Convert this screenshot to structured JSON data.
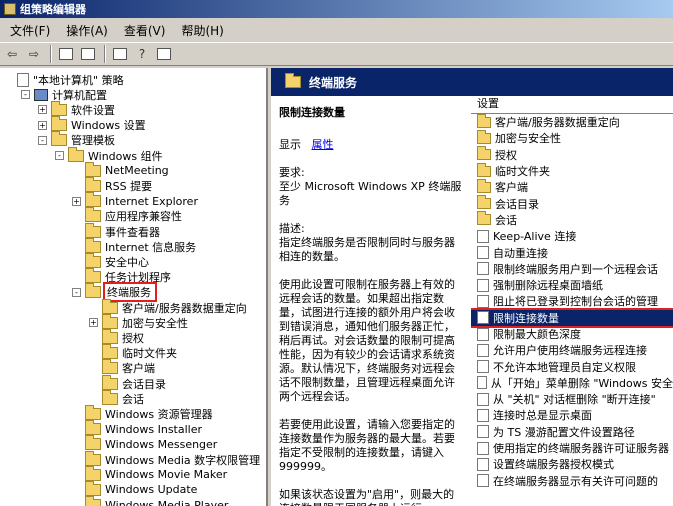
{
  "window": {
    "title": "组策略编辑器"
  },
  "menu": [
    "文件(F)",
    "操作(A)",
    "查看(V)",
    "帮助(H)"
  ],
  "toolbar": [
    "back-icon",
    "forward-icon",
    "up-folder-icon",
    "show-hide-tree-icon",
    "properties-icon",
    "help-icon",
    "extended-view-icon"
  ],
  "tree": [
    {
      "label": "\"本地计算机\" 策略",
      "indent": 0,
      "icon": "policy",
      "pm": "none"
    },
    {
      "label": "计算机配置",
      "indent": 1,
      "icon": "pc",
      "pm": "-"
    },
    {
      "label": "软件设置",
      "indent": 2,
      "icon": "folder",
      "pm": "+"
    },
    {
      "label": "Windows 设置",
      "indent": 2,
      "icon": "folder",
      "pm": "+"
    },
    {
      "label": "管理模板",
      "indent": 2,
      "icon": "folder",
      "pm": "-"
    },
    {
      "label": "Windows 组件",
      "indent": 3,
      "icon": "folder",
      "pm": "-"
    },
    {
      "label": "NetMeeting",
      "indent": 4,
      "icon": "folder",
      "pm": "none"
    },
    {
      "label": "RSS 提要",
      "indent": 4,
      "icon": "folder",
      "pm": "none"
    },
    {
      "label": "Internet Explorer",
      "indent": 4,
      "icon": "folder",
      "pm": "+"
    },
    {
      "label": "应用程序兼容性",
      "indent": 4,
      "icon": "folder",
      "pm": "none"
    },
    {
      "label": "事件查看器",
      "indent": 4,
      "icon": "folder",
      "pm": "none"
    },
    {
      "label": "Internet 信息服务",
      "indent": 4,
      "icon": "folder",
      "pm": "none"
    },
    {
      "label": "安全中心",
      "indent": 4,
      "icon": "folder",
      "pm": "none"
    },
    {
      "label": "任务计划程序",
      "indent": 4,
      "icon": "folder",
      "pm": "none"
    },
    {
      "label": "终端服务",
      "indent": 4,
      "icon": "folder",
      "pm": "-",
      "highlight": true
    },
    {
      "label": "客户端/服务器数据重定向",
      "indent": 5,
      "icon": "folder",
      "pm": "none"
    },
    {
      "label": "加密与安全性",
      "indent": 5,
      "icon": "folder",
      "pm": "+"
    },
    {
      "label": "授权",
      "indent": 5,
      "icon": "folder",
      "pm": "none"
    },
    {
      "label": "临时文件夹",
      "indent": 5,
      "icon": "folder",
      "pm": "none"
    },
    {
      "label": "客户端",
      "indent": 5,
      "icon": "folder",
      "pm": "none"
    },
    {
      "label": "会话目录",
      "indent": 5,
      "icon": "folder",
      "pm": "none"
    },
    {
      "label": "会话",
      "indent": 5,
      "icon": "folder",
      "pm": "none"
    },
    {
      "label": "Windows 资源管理器",
      "indent": 4,
      "icon": "folder",
      "pm": "none"
    },
    {
      "label": "Windows Installer",
      "indent": 4,
      "icon": "folder",
      "pm": "none"
    },
    {
      "label": "Windows Messenger",
      "indent": 4,
      "icon": "folder",
      "pm": "none"
    },
    {
      "label": "Windows Media 数字权限管理",
      "indent": 4,
      "icon": "folder",
      "pm": "none"
    },
    {
      "label": "Windows Movie Maker",
      "indent": 4,
      "icon": "folder",
      "pm": "none"
    },
    {
      "label": "Windows Update",
      "indent": 4,
      "icon": "folder",
      "pm": "none"
    },
    {
      "label": "Windows Media Player",
      "indent": 4,
      "icon": "folder",
      "pm": "none"
    }
  ],
  "right": {
    "header": "终端服务",
    "desc_title": "限制连接数量",
    "display_label": "显示",
    "properties_link": "属性",
    "requirements": "要求:\n至少 Microsoft Windows XP 终端服务",
    "description": "描述:\n指定终端服务是否限制同时与服务器相连的数量。",
    "para1": "使用此设置可限制在服务器上有效的远程会话的数量。如果超出指定数量，试图进行连接的额外用户将会收到错误消息，通知他们服务器正忙，稍后再试。对会话数量的限制可提高性能，因为有较少的会话请求系统资源。默认情况下，终端服务对远程会话不限制数量，且管理远程桌面允许两个远程会话。",
    "para2": "若要使用此设置，请输入您要指定的连接数量作为服务器的最大量。若要指定不受限制的连接数量，请键入 999999。",
    "para3": "如果该状态设置为\"启用\"，则最大的连接数量限于同服务器上运行",
    "column_header": "设置",
    "items": [
      {
        "label": "客户端/服务器数据重定向",
        "icon": "folder"
      },
      {
        "label": "加密与安全性",
        "icon": "folder"
      },
      {
        "label": "授权",
        "icon": "folder"
      },
      {
        "label": "临时文件夹",
        "icon": "folder"
      },
      {
        "label": "客户端",
        "icon": "folder"
      },
      {
        "label": "会话目录",
        "icon": "folder"
      },
      {
        "label": "会话",
        "icon": "folder"
      },
      {
        "label": "Keep-Alive 连接",
        "icon": "policy"
      },
      {
        "label": "自动重连接",
        "icon": "policy"
      },
      {
        "label": "限制终端服务用户到一个远程会话",
        "icon": "policy"
      },
      {
        "label": "强制删除远程桌面墙纸",
        "icon": "policy"
      },
      {
        "label": "阻止将已登录到控制台会话的管理",
        "icon": "policy"
      },
      {
        "label": "限制连接数量",
        "icon": "policy",
        "selected": true
      },
      {
        "label": "限制最大颜色深度",
        "icon": "policy"
      },
      {
        "label": "允许用户使用终端服务远程连接",
        "icon": "policy"
      },
      {
        "label": "不允许本地管理员自定义权限",
        "icon": "policy"
      },
      {
        "label": "从「开始」菜单删除 \"Windows 安全",
        "icon": "policy"
      },
      {
        "label": "从 \"关机\" 对话框删除 \"断开连接\"",
        "icon": "policy"
      },
      {
        "label": "连接时总是显示桌面",
        "icon": "policy"
      },
      {
        "label": "为 TS 漫游配置文件设置路径",
        "icon": "policy"
      },
      {
        "label": "使用指定的终端服务器许可证服务器",
        "icon": "policy"
      },
      {
        "label": "设置终端服务器授权模式",
        "icon": "policy"
      },
      {
        "label": "在终端服务器显示有关许可问题的",
        "icon": "policy"
      }
    ]
  }
}
